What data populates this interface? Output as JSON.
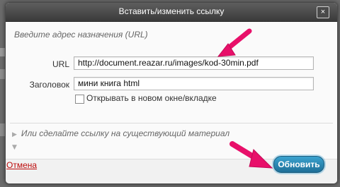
{
  "dialog": {
    "title": "Вставить/изменить ссылку",
    "close_label": "×",
    "hint": "Введите адрес назначения (URL)"
  },
  "form": {
    "url_label": "URL",
    "url_value": "http://document.reazar.ru/images/kod-30min.pdf",
    "title_label": "Заголовок",
    "title_value": "мини книга html",
    "new_window_label": "Открывать в новом окне/вкладке"
  },
  "link_existing": {
    "label": "Или сделайте ссылку на существующий материал"
  },
  "footer": {
    "cancel_label": "Отмена",
    "update_label": "Обновить"
  },
  "colors": {
    "annotation_arrow": "#e8106a",
    "primary_button": "#2a85b3",
    "cancel_link": "#bc0b0b"
  },
  "icons": {
    "expand": "triangle-right-icon",
    "annotation": "pink-arrow-icon"
  }
}
